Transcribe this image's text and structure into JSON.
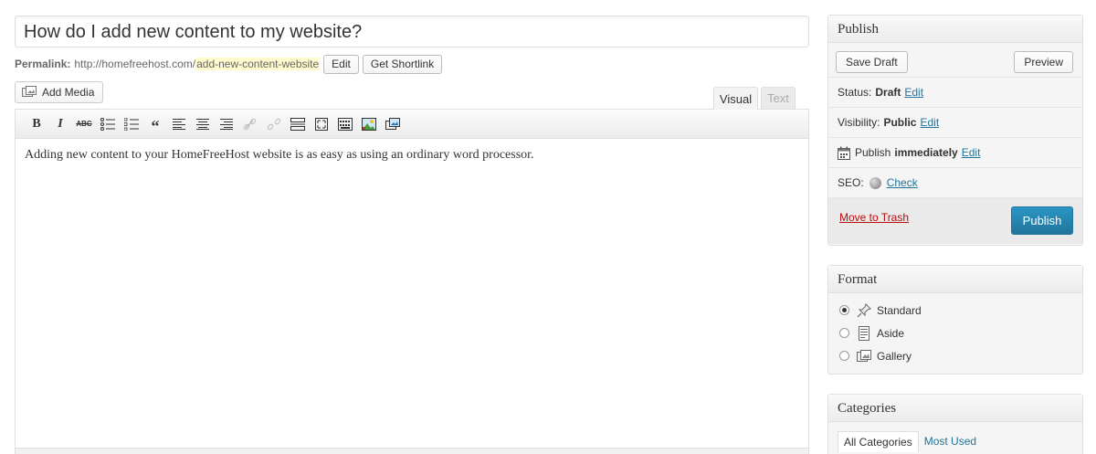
{
  "post": {
    "title": "How do I add new content to my website?",
    "permalink_label": "Permalink:",
    "permalink_base": "http://homefreehost.com/",
    "permalink_slug": "add-new-content-website",
    "edit_permalink_label": "Edit",
    "get_shortlink_label": "Get Shortlink",
    "content": "Adding new content to your HomeFreeHost website is as easy as using an ordinary word processor."
  },
  "media": {
    "add_media_label": "Add Media"
  },
  "editor_tabs": {
    "visual": "Visual",
    "text": "Text"
  },
  "toolbar": {
    "bold": "B",
    "italic": "I",
    "strike": "ABC",
    "blockquote": "“"
  },
  "publish": {
    "title": "Publish",
    "save_draft_label": "Save Draft",
    "preview_label": "Preview",
    "status_label": "Status:",
    "status_value": "Draft",
    "visibility_label": "Visibility:",
    "visibility_value": "Public",
    "schedule_label": "Publish",
    "schedule_value": "immediately",
    "edit_label": "Edit",
    "seo_label": "SEO:",
    "seo_check": "Check",
    "trash_label": "Move to Trash",
    "publish_label": "Publish"
  },
  "format": {
    "title": "Format",
    "options": [
      "Standard",
      "Aside",
      "Gallery"
    ],
    "selected": "Standard"
  },
  "categories": {
    "title": "Categories",
    "tabs": [
      "All Categories",
      "Most Used"
    ]
  },
  "colors": {
    "accent": "#21759b",
    "danger": "#bc0b0b",
    "slug_highlight": "#fffbcc"
  }
}
